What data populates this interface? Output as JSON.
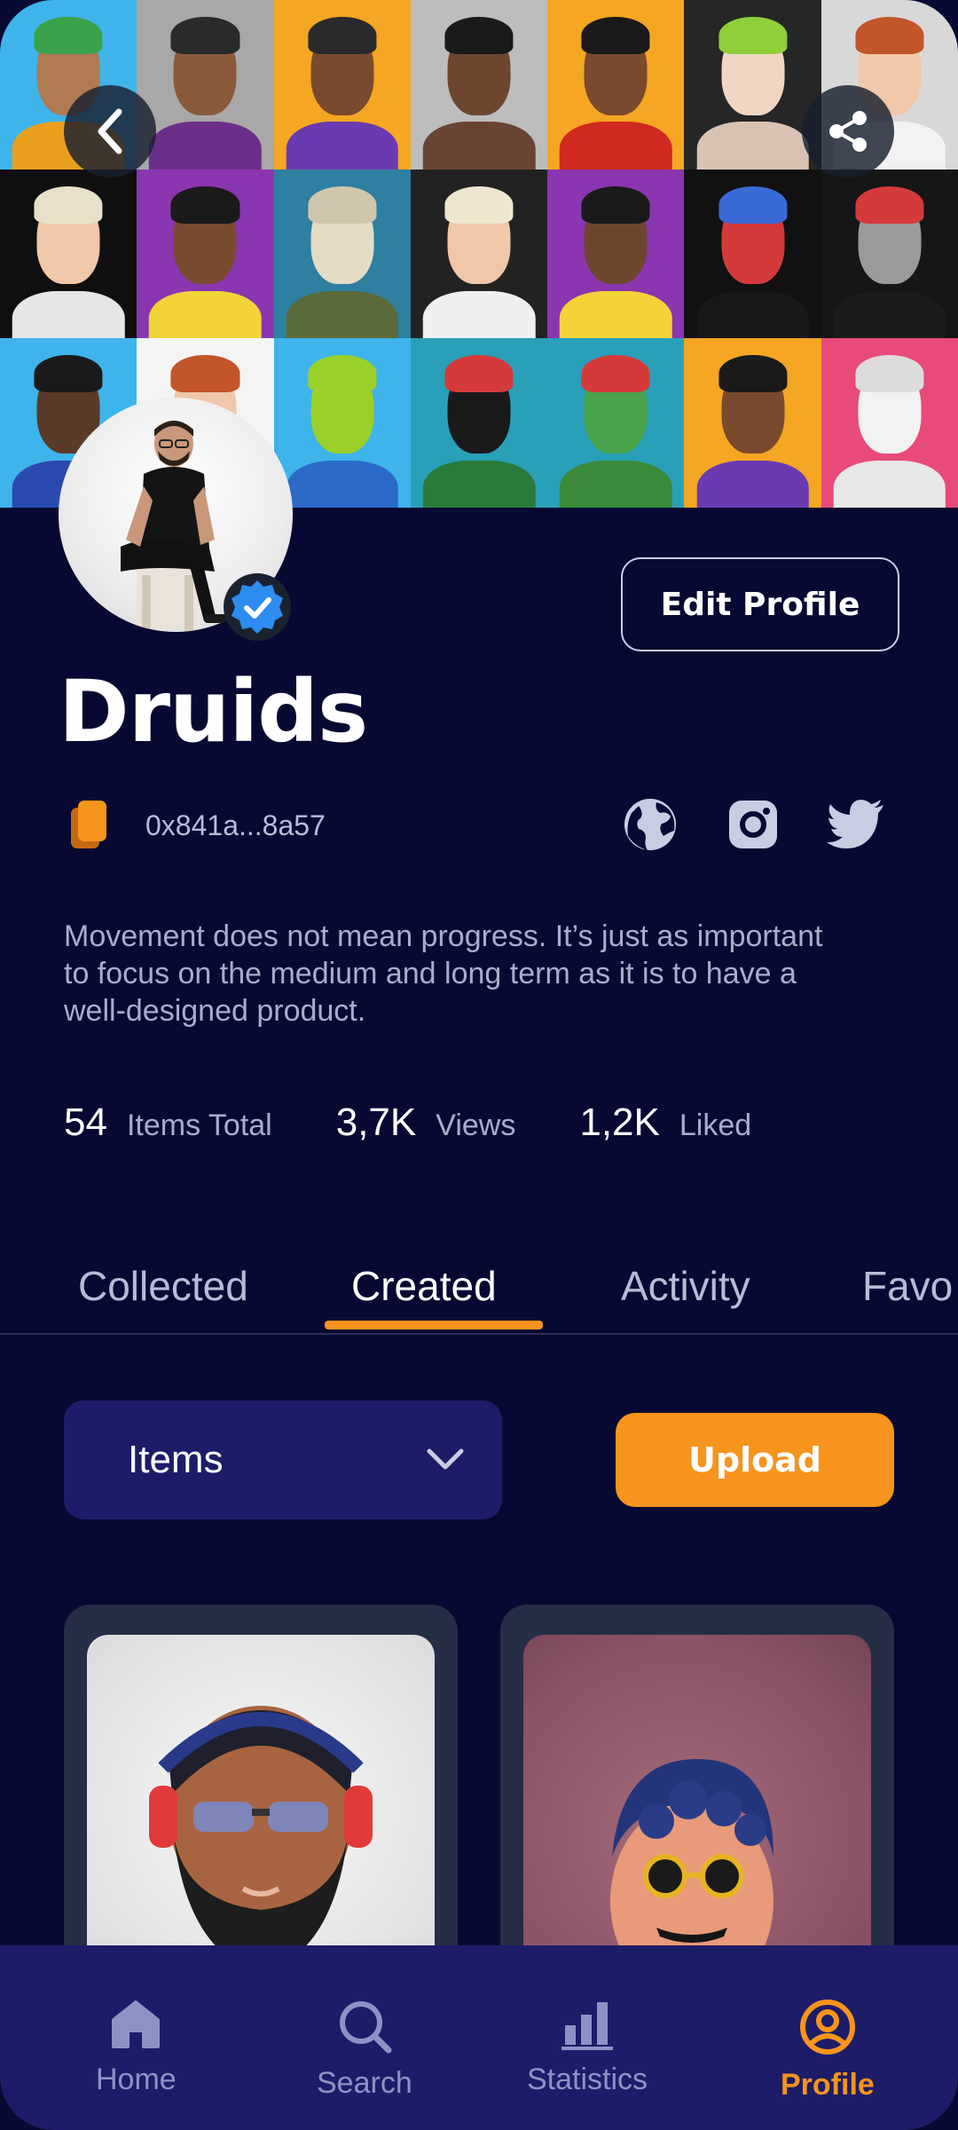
{
  "profile": {
    "name": "Druids",
    "wallet_address": "0x841a...8a57",
    "bio": "Movement does not mean progress. It’s just as important to focus on the medium and long term as it is to have a well-designed product.",
    "verified": true
  },
  "header": {
    "back_icon": "chevron-left-icon",
    "share_icon": "share-icon",
    "edit_profile_label": "Edit Profile"
  },
  "socials": [
    "globe-icon",
    "instagram-icon",
    "twitter-icon"
  ],
  "stats": [
    {
      "value": "54",
      "label": "Items Total"
    },
    {
      "value": "3,7K",
      "label": "Views"
    },
    {
      "value": "1,2K",
      "label": "Liked"
    }
  ],
  "tabs": [
    {
      "label": "Collected",
      "active": false
    },
    {
      "label": "Created",
      "active": true
    },
    {
      "label": "Activity",
      "active": false
    },
    {
      "label": "Favo",
      "active": false
    }
  ],
  "filter": {
    "selected": "Items",
    "upload_label": "Upload"
  },
  "nav": [
    {
      "label": "Home",
      "icon": "home-icon",
      "active": false
    },
    {
      "label": "Search",
      "icon": "search-icon",
      "active": false
    },
    {
      "label": "Statistics",
      "icon": "bar-chart-icon",
      "active": false
    },
    {
      "label": "Profile",
      "icon": "user-circle-icon",
      "active": true
    }
  ],
  "colors": {
    "background": "#070932",
    "accent": "#f7941d",
    "nav_background": "#1c1c68",
    "verified_badge": "#2d8cf0"
  }
}
